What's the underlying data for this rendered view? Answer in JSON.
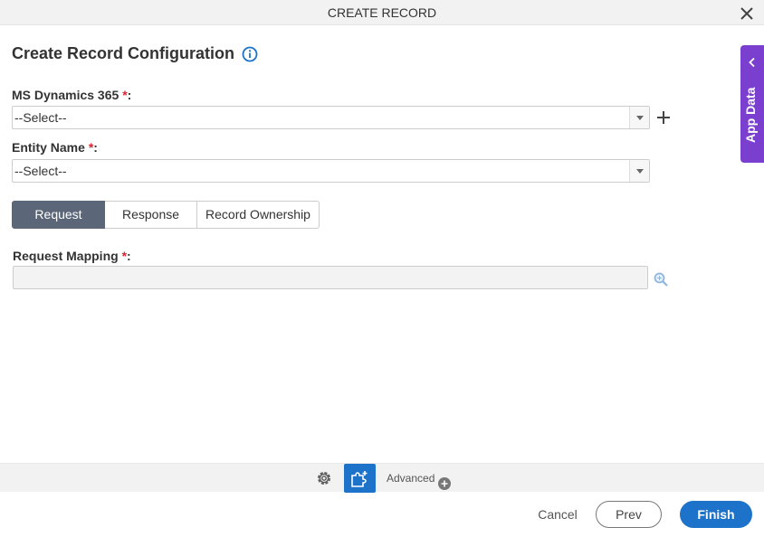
{
  "dialog": {
    "title": "CREATE RECORD",
    "heading": "Create Record Configuration"
  },
  "fields": {
    "ms_dynamics": {
      "label": "MS Dynamics 365",
      "required_mark": "*",
      "colon": ":",
      "value": "--Select--"
    },
    "entity_name": {
      "label": "Entity Name",
      "required_mark": "*",
      "colon": ":",
      "value": "--Select--"
    },
    "request_mapping": {
      "label": "Request Mapping",
      "required_mark": "*",
      "colon": ":"
    }
  },
  "tabs": [
    {
      "label": "Request",
      "active": true
    },
    {
      "label": "Response",
      "active": false
    },
    {
      "label": "Record Ownership",
      "active": false
    }
  ],
  "side_panel": {
    "label": "App Data"
  },
  "bottom_bar": {
    "advanced_label": "Advanced"
  },
  "footer": {
    "cancel_label": "Cancel",
    "prev_label": "Prev",
    "finish_label": "Finish"
  },
  "colors": {
    "accent": "#1d72c9",
    "side_panel": "#7b3fd0",
    "active_tab": "#5b6778",
    "required": "#d9232e"
  }
}
